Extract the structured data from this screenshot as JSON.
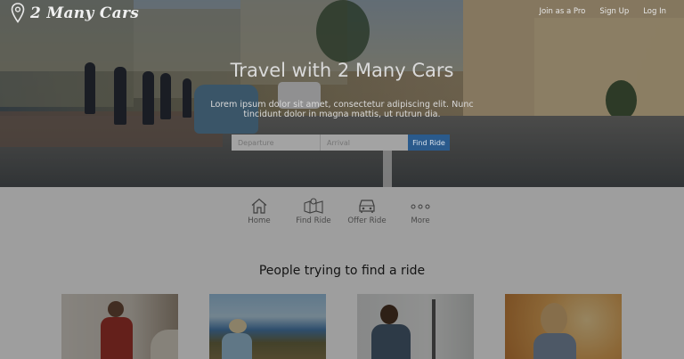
{
  "brand": {
    "name": "2 Many Cars",
    "logo_icon": "map-pin-icon"
  },
  "nav": {
    "links": [
      {
        "label": "Join as a Pro"
      },
      {
        "label": "Sign Up"
      },
      {
        "label": "Log In"
      }
    ]
  },
  "hero": {
    "title": "Travel with 2 Many Cars",
    "subtitle": "Lorem ipsum dolor sit amet, consectetur adipiscing elit. Nunc tincidunt dolor in magna mattis, ut rutrun dia.",
    "departure_placeholder": "Departure",
    "arrival_placeholder": "Arrival",
    "search_button": "Find Ride"
  },
  "features": [
    {
      "label": "Home",
      "icon": "home-icon"
    },
    {
      "label": "Find Ride",
      "icon": "map-search-icon"
    },
    {
      "label": "Offer Ride",
      "icon": "car-icon"
    },
    {
      "label": "More",
      "icon": "more-dots-icon"
    }
  ],
  "section": {
    "title": "People trying to find a ride"
  },
  "colors": {
    "accent": "#2a5a8c",
    "overlay": "rgba(0,0,0,0.38)"
  }
}
